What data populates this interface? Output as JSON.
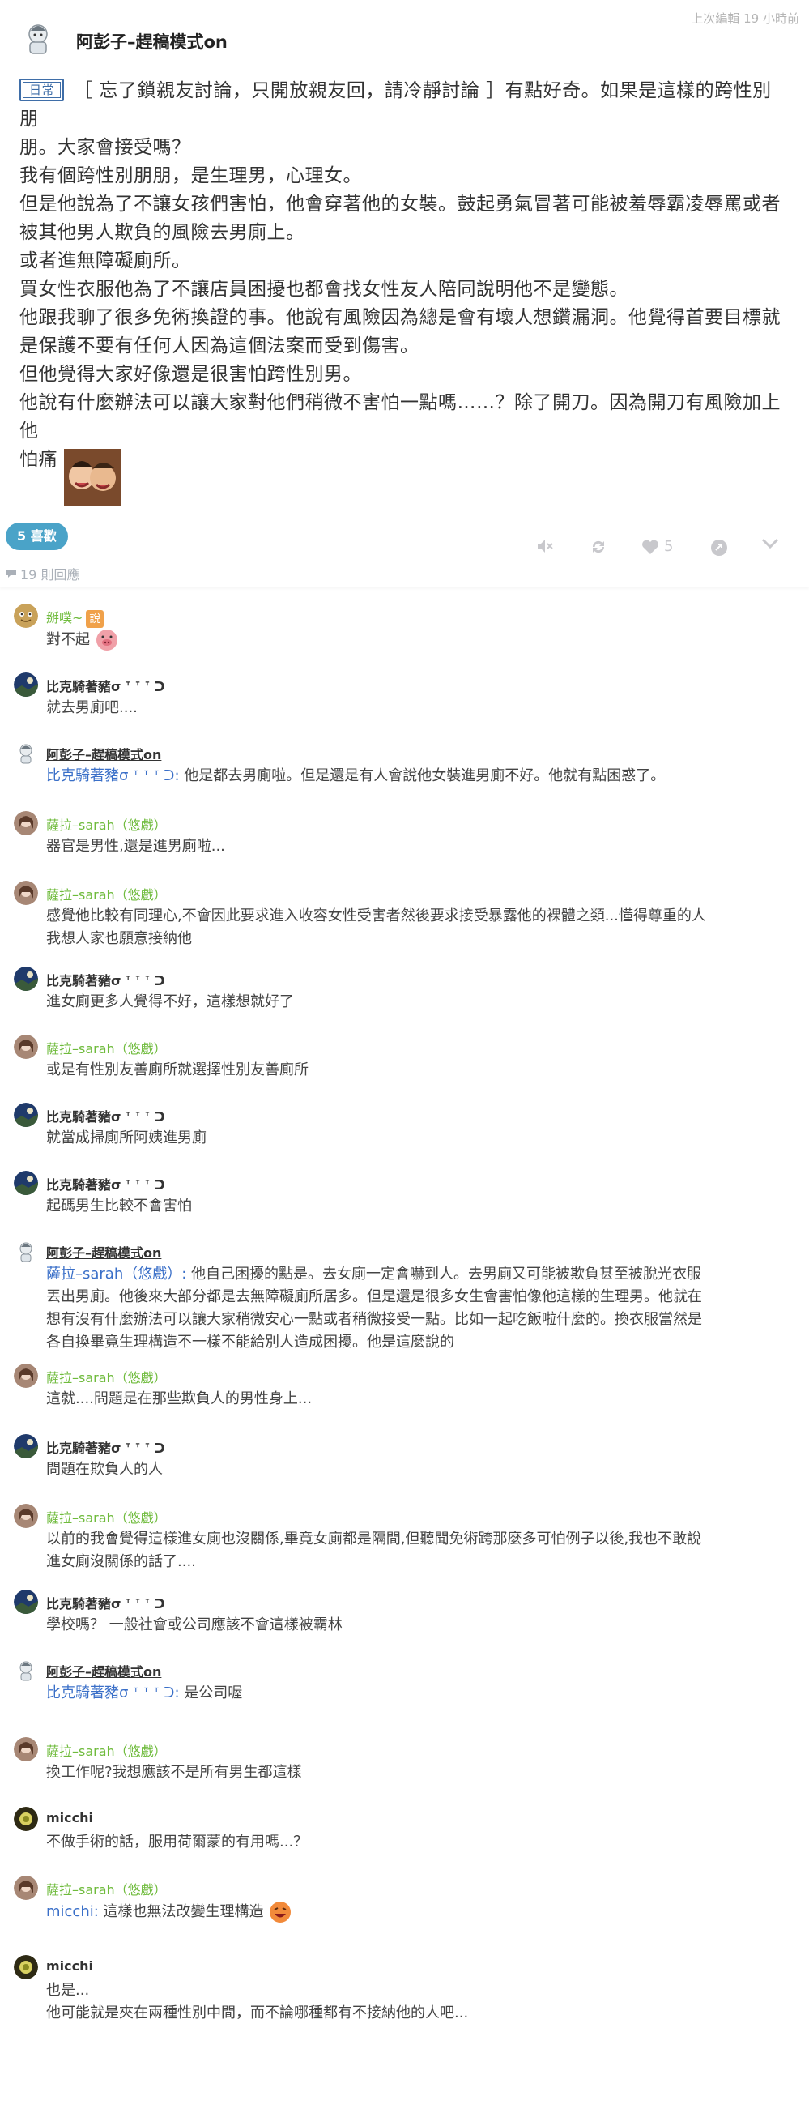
{
  "post": {
    "author": "阿彭子–趕稿模式on",
    "edited": "上次編輯 19 小時前",
    "tag": "日常",
    "lines": [
      "［ 忘了鎖親友討論，只開放親友回，請冷靜討論 ］有點好奇。如果是這樣的跨性別朋",
      "朋。大家會接受嗎？",
      "我有個跨性別朋朋，是生理男，心理女。",
      "但是他說為了不讓女孩們害怕，他會穿著他的女裝。鼓起勇氣冒著可能被羞辱霸凌辱罵或者",
      "被其他男人欺負的風險去男廁上。",
      "或者進無障礙廁所。",
      "買女性衣服他為了不讓店員困擾也都會找女性友人陪同說明他不是變態。",
      "他跟我聊了很多免術換證的事。他說有風險因為總是會有壞人想鑽漏洞。他覺得首要目標就",
      "是保護不要有任何人因為這個法案而受到傷害。",
      "但他覺得大家好像還是很害怕跨性別男。",
      "他說有什麼辦法可以讓大家對他們稍微不害怕一點嗎……？除了開刀。因為開刀有風險加上他",
      "怕痛"
    ],
    "like_count": "5"
  },
  "likes_label": "5 喜歡",
  "reply_count": "19 則回應",
  "comments": [
    {
      "name": "掰噗~",
      "text": "對不起",
      "style": "green",
      "avatar": "plurk"
    },
    {
      "name": "比克騎著豬σ ᐪ ᐪ ᐪ ᑐ",
      "text": "就去男廁吧....",
      "style": "dark",
      "avatar": "blue"
    },
    {
      "name": "阿彭子–趕稿模式on",
      "mention": "比克騎著豬σ ᐪ ᐪ ᐪ ᑐ:",
      "text": " 他是都去男廁啦。但是還是有人會說他女裝進男廁不好。他就有點困惑了。",
      "style": "underline",
      "avatar": "author"
    },
    {
      "name": "薩拉–sarah（悠戲）",
      "text": "器官是男性,還是進男廁啦...",
      "style": "green",
      "avatar": "sarah"
    },
    {
      "name": "薩拉–sarah（悠戲）",
      "text": "感覺他比較有同理心,不會因此要求進入收容女性受害者然後要求接受暴露他的裸體之類...懂得尊重的人",
      "text2": "我想人家也願意接納他",
      "style": "green",
      "avatar": "sarah"
    },
    {
      "name": "比克騎著豬σ ᐪ ᐪ ᐪ ᑐ",
      "text": "進女廁更多人覺得不好，這樣想就好了",
      "style": "dark",
      "avatar": "blue"
    },
    {
      "name": "薩拉–sarah（悠戲）",
      "text": "或是有性別友善廁所就選擇性別友善廁所",
      "style": "green",
      "avatar": "sarah"
    },
    {
      "name": "比克騎著豬σ ᐪ ᐪ ᐪ ᑐ",
      "text": "就當成掃廁所阿姨進男廁",
      "style": "dark",
      "avatar": "blue"
    },
    {
      "name": "比克騎著豬σ ᐪ ᐪ ᐪ ᑐ",
      "text": "起碼男生比較不會害怕",
      "style": "dark",
      "avatar": "blue"
    },
    {
      "name": "阿彭子–趕稿模式on",
      "mention": "薩拉–sarah（悠戲）:",
      "text": " 他自己困擾的點是。去女廁一定會嚇到人。去男廁又可能被欺負甚至被脫光衣服",
      "text2": "丟出男廁。他後來大部分都是去無障礙廁所居多。但是還是很多女生會害怕像他這樣的生理男。他就在",
      "text3": "想有沒有什麼辦法可以讓大家稍微安心一點或者稍微接受一點。比如一起吃飯啦什麼的。換衣服當然是",
      "text4": "各自換畢竟生理構造不一樣不能給別人造成困擾。他是這麼說的",
      "style": "underline",
      "avatar": "author"
    },
    {
      "name": "薩拉–sarah（悠戲）",
      "text": "這就....問題是在那些欺負人的男性身上...",
      "style": "green",
      "avatar": "sarah"
    },
    {
      "name": "比克騎著豬σ ᐪ ᐪ ᐪ ᑐ",
      "text": "問題在欺負人的人",
      "style": "dark",
      "avatar": "blue"
    },
    {
      "name": "薩拉–sarah（悠戲）",
      "text": "以前的我會覺得這樣進女廁也沒關係,畢竟女廁都是隔間,但聽聞免術跨那麼多可怕例子以後,我也不敢說",
      "text2": "進女廁沒關係的話了....",
      "style": "green",
      "avatar": "sarah"
    },
    {
      "name": "比克騎著豬σ ᐪ ᐪ ᐪ ᑐ",
      "text": "學校嗎？ 一般社會或公司應該不會這樣被霸林",
      "style": "dark",
      "avatar": "blue"
    },
    {
      "name": "阿彭子–趕稿模式on",
      "mention": "比克騎著豬σ ᐪ ᐪ ᐪ ᑐ:",
      "text": " 是公司喔",
      "style": "underline",
      "avatar": "author"
    },
    {
      "name": "薩拉–sarah（悠戲）",
      "text": "換工作呢?我想應該不是所有男生都這樣",
      "style": "green",
      "avatar": "sarah"
    },
    {
      "name": "micchi",
      "text": "不做手術的話，服用荷爾蒙的有用嗎...？",
      "style": "dark",
      "avatar": "micchi"
    },
    {
      "name": "薩拉–sarah（悠戲）",
      "mention": "micchi:",
      "text": " 這樣也無法改變生理構造",
      "style": "green",
      "avatar": "sarah"
    },
    {
      "name": "micchi",
      "text": "也是...",
      "text2": "他可能就是夾在兩種性別中間，而不論哪種都有不接納他的人吧...",
      "style": "dark",
      "avatar": "micchi"
    }
  ]
}
